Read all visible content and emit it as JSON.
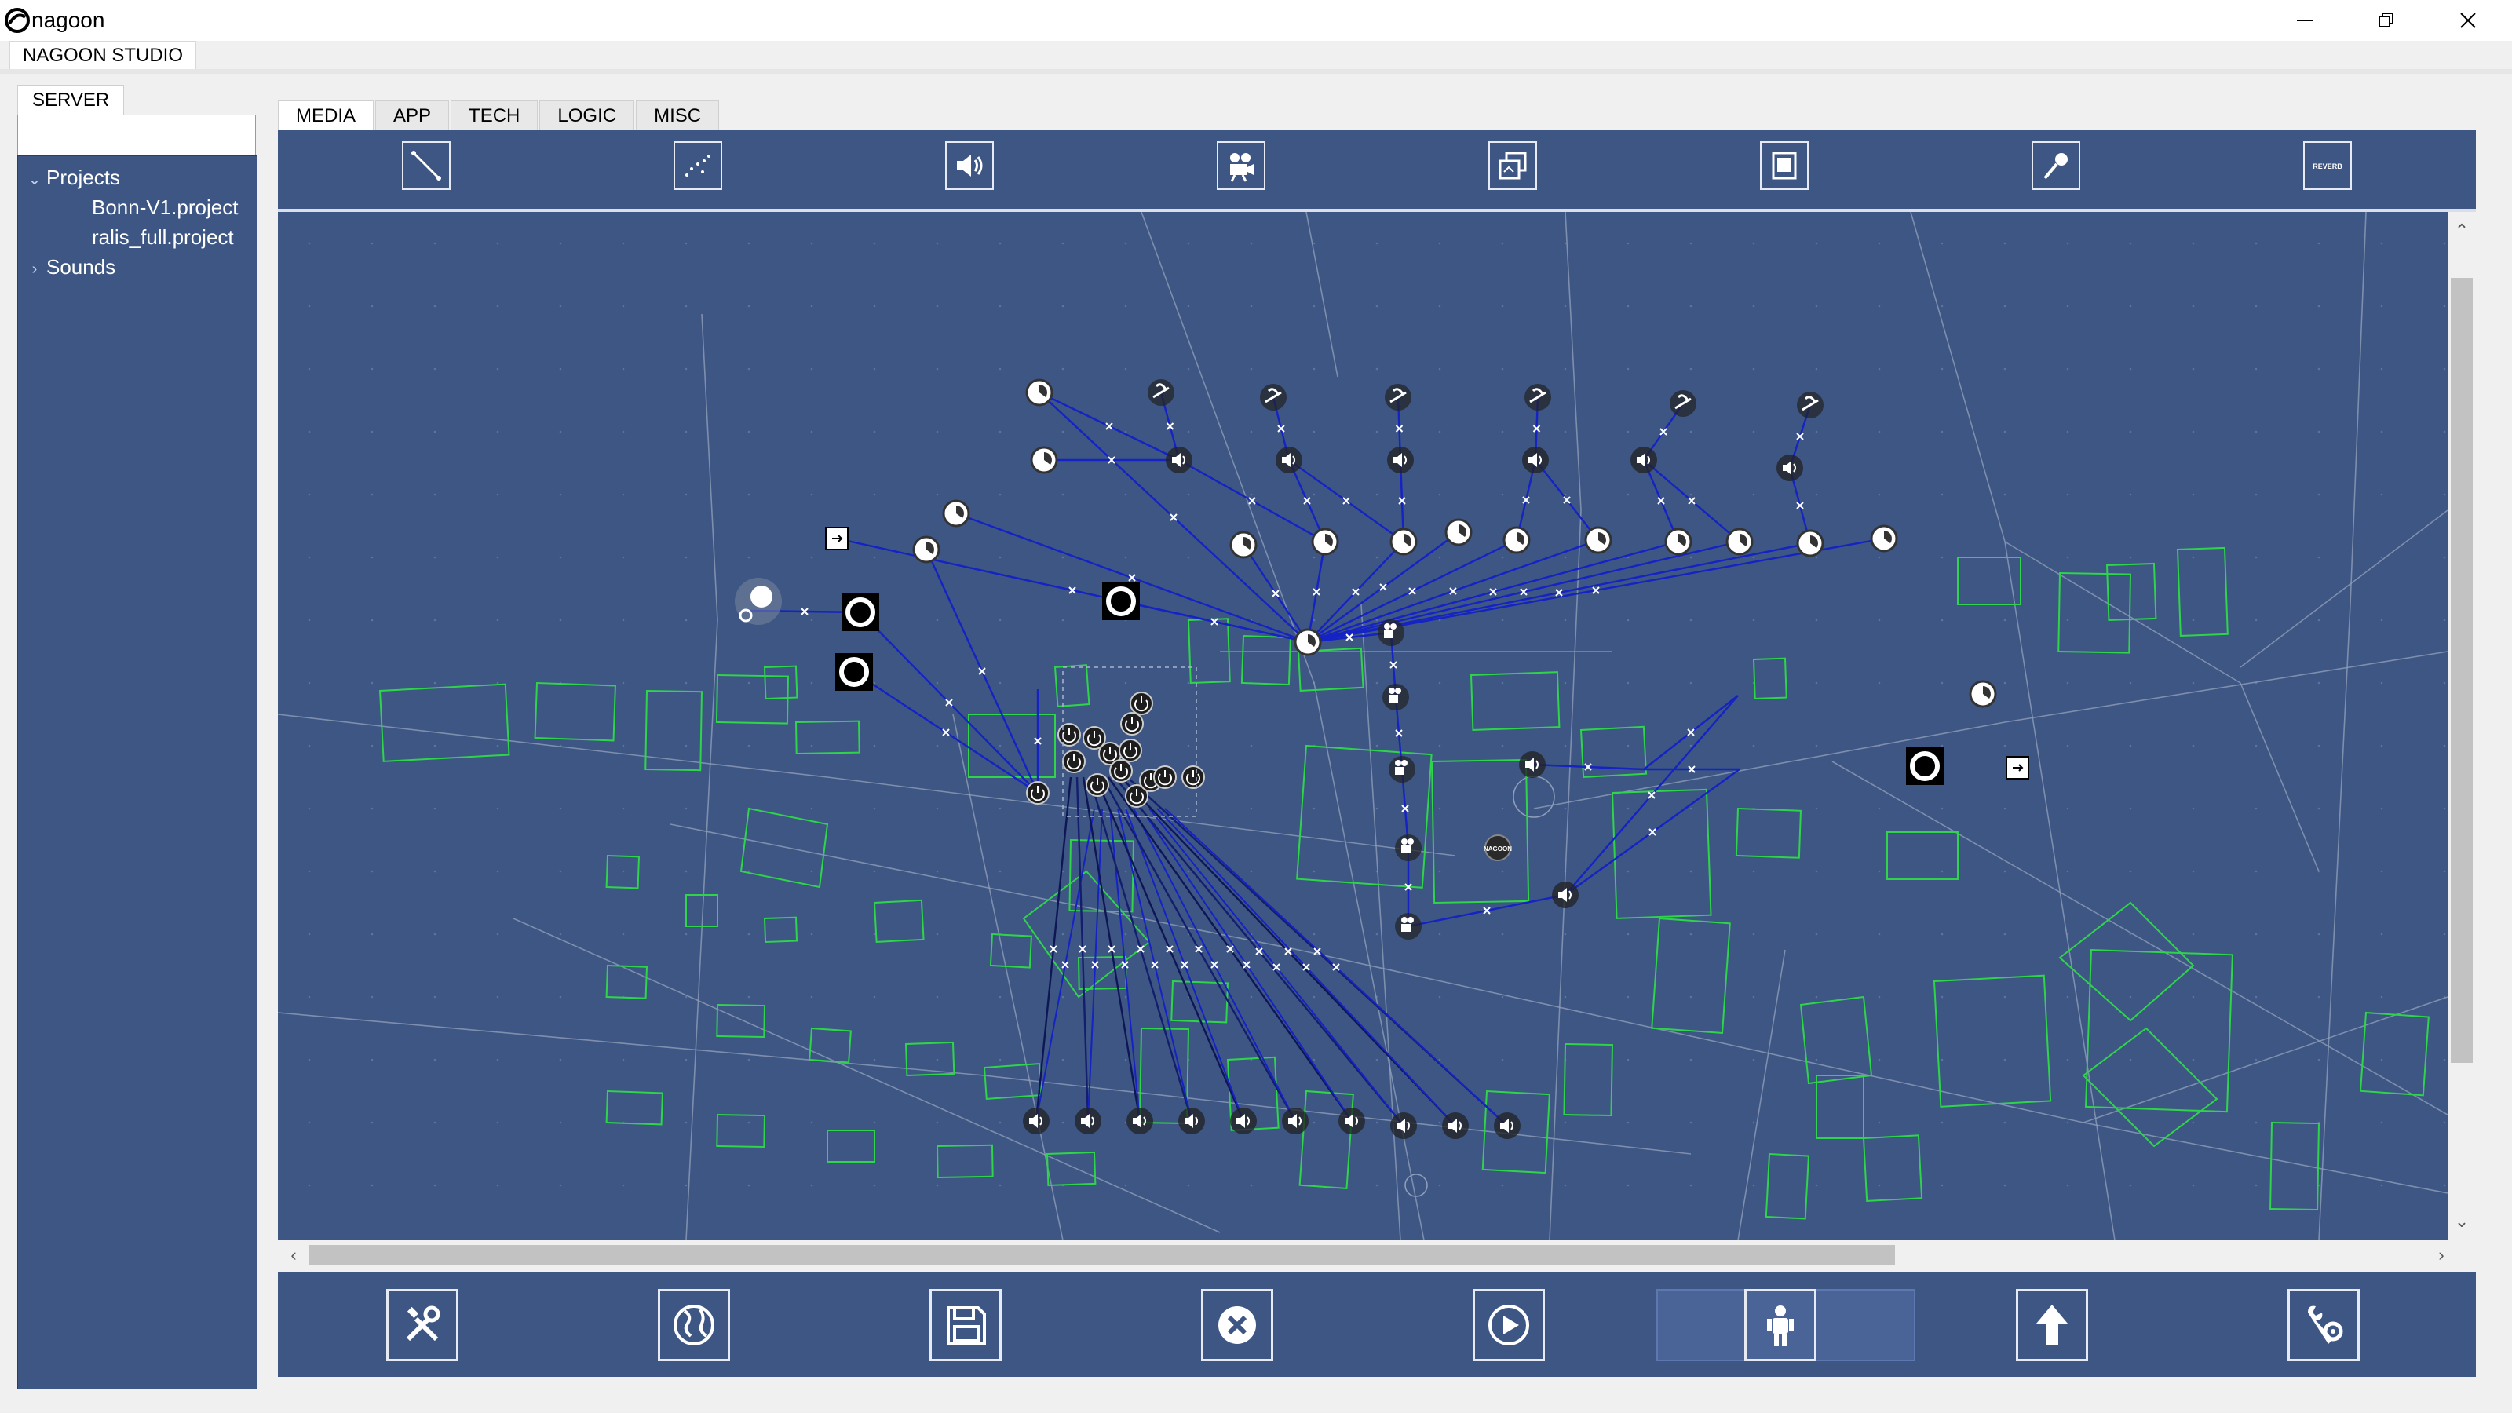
{
  "window": {
    "title": "nagoon",
    "controls": [
      "minimize-icon",
      "restore-icon",
      "close-icon"
    ]
  },
  "studio_tab": "NAGOON STUDIO",
  "server": {
    "tab_label": "SERVER",
    "search_value": "",
    "tree": [
      {
        "label": "Projects",
        "expanded": true
      },
      {
        "label": "Bonn-V1.project"
      },
      {
        "label": "ralis_full.project"
      },
      {
        "label": "Sounds",
        "expanded": false
      }
    ]
  },
  "tabs": [
    {
      "label": "MEDIA",
      "active": true
    },
    {
      "label": "APP"
    },
    {
      "label": "TECH"
    },
    {
      "label": "LOGIC"
    },
    {
      "label": "MISC"
    }
  ],
  "media_tools": [
    {
      "icon": "line-tool-icon"
    },
    {
      "icon": "dotted-path-icon"
    },
    {
      "icon": "speaker-icon"
    },
    {
      "icon": "camera-icon"
    },
    {
      "icon": "copy-media-icon"
    },
    {
      "icon": "panel-icon"
    },
    {
      "icon": "microphone-icon"
    },
    {
      "icon": "reverb-icon",
      "label": "REVERB"
    }
  ],
  "map": {
    "center_label": "NAGOON",
    "colors": {
      "background": "#3d5684",
      "buildings": "#2fd44a",
      "streets": "#8e9db8",
      "links": "#1522c4"
    }
  },
  "bottom_tools": [
    {
      "icon": "tools-icon"
    },
    {
      "icon": "globe-icon"
    },
    {
      "icon": "save-icon"
    },
    {
      "icon": "cancel-icon"
    },
    {
      "icon": "play-icon"
    },
    {
      "icon": "person-icon"
    },
    {
      "icon": "upload-arrow-icon"
    },
    {
      "icon": "wrench-settings-icon"
    }
  ]
}
